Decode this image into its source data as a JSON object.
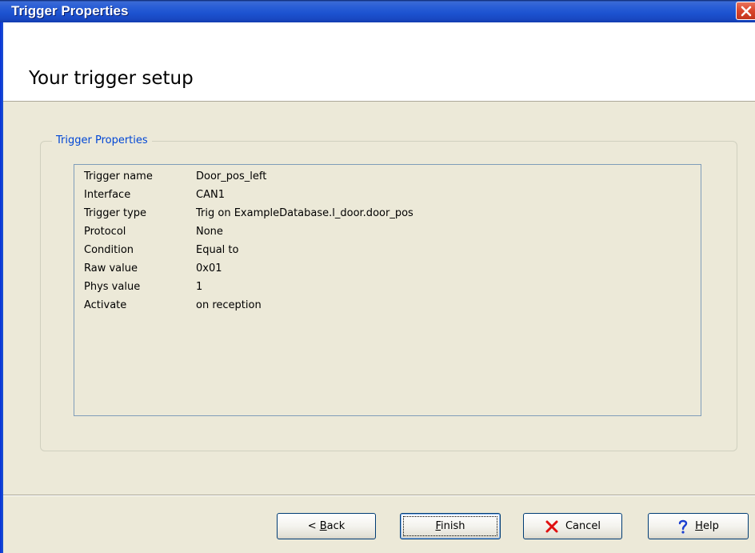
{
  "window": {
    "title": "Trigger Properties"
  },
  "header": {
    "heading": "Your trigger setup"
  },
  "group": {
    "legend": "Trigger Properties",
    "properties": [
      {
        "key": "Trigger name",
        "value": "Door_pos_left"
      },
      {
        "key": "Interface",
        "value": "CAN1"
      },
      {
        "key": "Trigger type",
        "value": "Trig on ExampleDatabase.l_door.door_pos"
      },
      {
        "key": "Protocol",
        "value": "None"
      },
      {
        "key": "Condition",
        "value": "Equal to"
      },
      {
        "key": "Raw value",
        "value": "0x01"
      },
      {
        "key": "Phys value",
        "value": "1"
      },
      {
        "key": "Activate",
        "value": "on reception"
      }
    ]
  },
  "buttons": {
    "back": {
      "prefix": "< ",
      "mnemonic": "B",
      "rest": "ack"
    },
    "finish": {
      "mnemonic": "F",
      "rest": "inish"
    },
    "cancel": {
      "label": "Cancel",
      "icon": "red-x-icon"
    },
    "help": {
      "mnemonic": "H",
      "rest": "elp",
      "icon": "question-mark-icon"
    }
  },
  "colors": {
    "title_bar": "#1c52d0",
    "dialog_background": "#ece9d8",
    "group_legend": "#0046d5",
    "close_button": "#d9452c"
  }
}
